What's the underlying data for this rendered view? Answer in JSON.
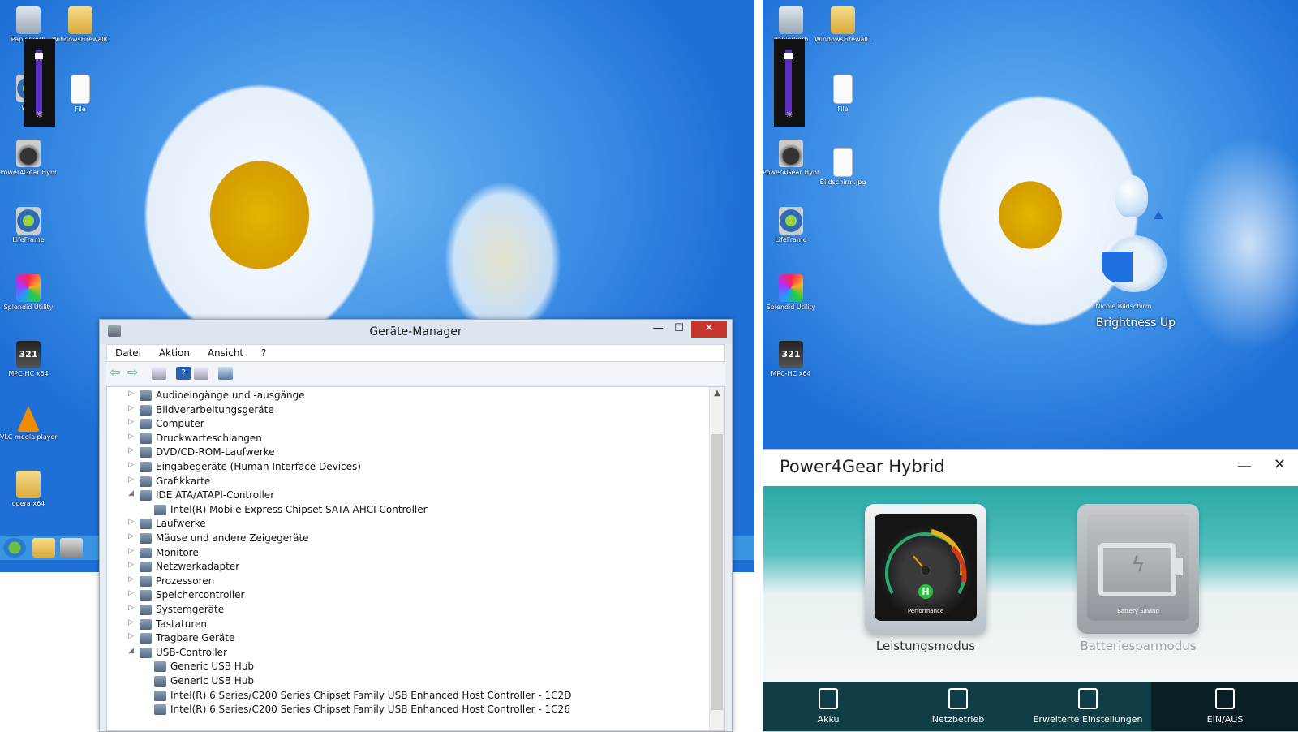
{
  "desktop_left": {
    "icons": [
      {
        "label": "Papierkorb",
        "kind": "bin"
      },
      {
        "label": "WindowsFirewallControl",
        "kind": "folder"
      },
      {
        "label": "Wi...",
        "kind": "gear"
      },
      {
        "label": "File",
        "kind": "file"
      },
      {
        "label": "Power4Gear Hybrid",
        "kind": "gauge"
      },
      {
        "label": "LifeFrame",
        "kind": "gear"
      },
      {
        "label": "Splendid Utility",
        "kind": "splendid"
      },
      {
        "label": "MPC-HC x64",
        "kind": "mpc"
      },
      {
        "label": "VLC media player",
        "kind": "vlc"
      },
      {
        "label": "opera x64",
        "kind": "folder"
      }
    ]
  },
  "desktop_right": {
    "icons": [
      {
        "label": "Papierkorb",
        "kind": "bin"
      },
      {
        "label": "WindowsFirewall...",
        "kind": "folder"
      },
      {
        "label": "Wi...",
        "kind": "gear"
      },
      {
        "label": "File",
        "kind": "file"
      },
      {
        "label": "Power4Gear Hybrid",
        "kind": "gauge"
      },
      {
        "label": "Bildschirm.jpg",
        "kind": "file"
      },
      {
        "label": "LifeFrame",
        "kind": "gear"
      },
      {
        "label": "Splendid Utility",
        "kind": "splendid"
      },
      {
        "label": "MPC-HC x64",
        "kind": "mpc"
      }
    ],
    "osd_text": "Brightness Up",
    "osd_sub": "Nicole Bildschirm"
  },
  "brightness_level": 0.15,
  "device_manager": {
    "title": "Geräte-Manager",
    "menu": [
      "Datei",
      "Aktion",
      "Ansicht",
      "?"
    ],
    "tree": [
      {
        "label": "Audioeingänge und -ausgänge",
        "level": 0,
        "expanded": false
      },
      {
        "label": "Bildverarbeitungsgeräte",
        "level": 0,
        "expanded": false
      },
      {
        "label": "Computer",
        "level": 0,
        "expanded": false
      },
      {
        "label": "Druckwarteschlangen",
        "level": 0,
        "expanded": false
      },
      {
        "label": "DVD/CD-ROM-Laufwerke",
        "level": 0,
        "expanded": false
      },
      {
        "label": "Eingabegeräte (Human Interface Devices)",
        "level": 0,
        "expanded": false
      },
      {
        "label": "Grafikkarte",
        "level": 0,
        "expanded": false
      },
      {
        "label": "IDE ATA/ATAPI-Controller",
        "level": 0,
        "expanded": true
      },
      {
        "label": "Intel(R) Mobile Express Chipset SATA AHCI Controller",
        "level": 1,
        "expanded": null
      },
      {
        "label": "Laufwerke",
        "level": 0,
        "expanded": false
      },
      {
        "label": "Mäuse und andere Zeigegeräte",
        "level": 0,
        "expanded": false
      },
      {
        "label": "Monitore",
        "level": 0,
        "expanded": false
      },
      {
        "label": "Netzwerkadapter",
        "level": 0,
        "expanded": false
      },
      {
        "label": "Prozessoren",
        "level": 0,
        "expanded": false
      },
      {
        "label": "Speichercontroller",
        "level": 0,
        "expanded": false
      },
      {
        "label": "Systemgeräte",
        "level": 0,
        "expanded": false
      },
      {
        "label": "Tastaturen",
        "level": 0,
        "expanded": false
      },
      {
        "label": "Tragbare Geräte",
        "level": 0,
        "expanded": false
      },
      {
        "label": "USB-Controller",
        "level": 0,
        "expanded": true
      },
      {
        "label": "Generic USB Hub",
        "level": 1,
        "expanded": null
      },
      {
        "label": "Generic USB Hub",
        "level": 1,
        "expanded": null
      },
      {
        "label": "Intel(R) 6 Series/C200 Series Chipset Family USB Enhanced Host Controller - 1C2D",
        "level": 1,
        "expanded": null
      },
      {
        "label": "Intel(R) 6 Series/C200 Series Chipset Family USB Enhanced Host Controller - 1C26",
        "level": 1,
        "expanded": null
      }
    ],
    "arrow_collapsed": "▷",
    "arrow_expanded": "◢"
  },
  "power4gear": {
    "title": "Power4Gear Hybrid",
    "minimize": "—",
    "close": "✕",
    "modes": [
      {
        "label": "Leistungsmodus",
        "caption": "Performance",
        "badge": "H",
        "active": true
      },
      {
        "label": "Batteriesparmodus",
        "caption": "Battery Saving",
        "badge": "",
        "active": false
      }
    ],
    "nav": [
      {
        "label": "Akku",
        "icon": "battery-icon"
      },
      {
        "label": "Netzbetrieb",
        "icon": "plug-icon"
      },
      {
        "label": "Erweiterte Einstellungen",
        "icon": "settings-icon"
      },
      {
        "label": "EIN/AUS",
        "icon": "power-icon",
        "active": true
      }
    ]
  },
  "colors": {
    "close_red": "#c7362d",
    "p4g_teal": "#2aa8a6",
    "p4g_nav": "#0f3e47",
    "brightness_track": "#5a2fc2"
  }
}
